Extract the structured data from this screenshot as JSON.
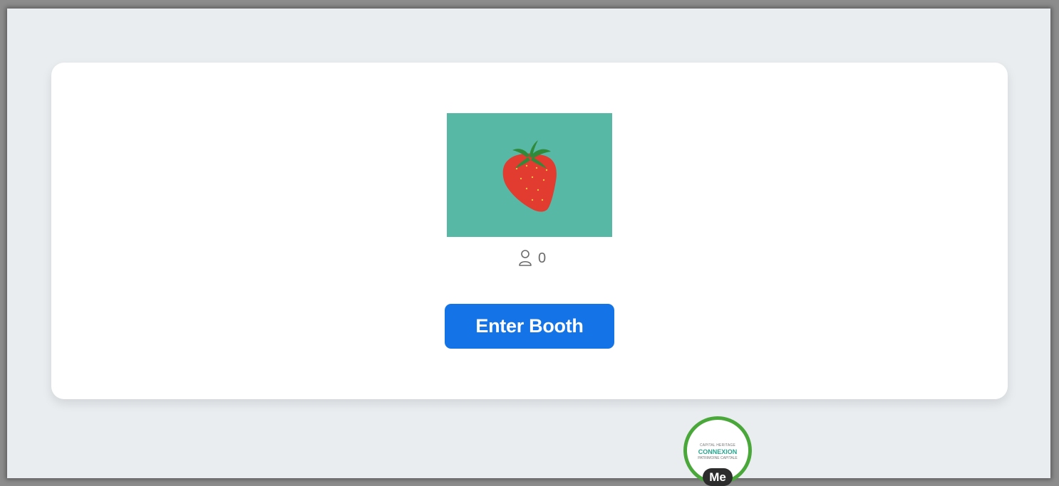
{
  "booth": {
    "image_icon": "strawberry-image",
    "visitor_icon": "person-icon",
    "visitor_count": "0",
    "enter_button_label": "Enter Booth"
  },
  "me": {
    "avatar_logo": {
      "top_line": "CAPITAL HERITAGE",
      "main": "CONNEXION",
      "bottom_line": "PATRIMOINE CAPITALE"
    },
    "label": "Me"
  },
  "colors": {
    "accent": "#1473e6",
    "image_background": "#57b8a5",
    "avatar_ring": "#4aa83a",
    "page_background": "#e9edf0"
  }
}
